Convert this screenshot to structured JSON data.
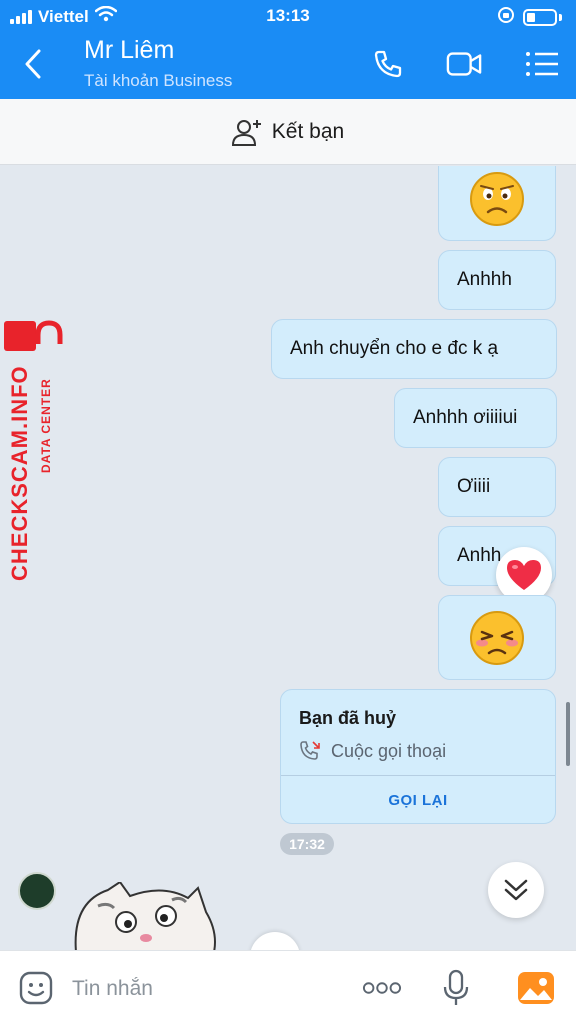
{
  "status_bar": {
    "carrier": "Viettel",
    "time": "13:13"
  },
  "header": {
    "title": "Mr Liêm",
    "subtitle": "Tài khoản Business"
  },
  "friend_bar": {
    "label": "Kết bạn"
  },
  "watermark": {
    "brand": "CHECKSCAM.INFO",
    "tagline": "DATA CENTER",
    "color": "#e8232b"
  },
  "messages": [
    {
      "type": "emoji",
      "icon": "worried-face-icon"
    },
    {
      "type": "text",
      "text": "Anhhh"
    },
    {
      "type": "text",
      "text": "Anh chuyển cho e đc k ạ"
    },
    {
      "type": "text",
      "text": "Anhhh ơiiiiui"
    },
    {
      "type": "text",
      "text": "Ơiiii"
    },
    {
      "type": "text",
      "text": "Anhh",
      "reaction": "heart-icon"
    },
    {
      "type": "emoji",
      "icon": "angry-face-icon"
    }
  ],
  "call_card": {
    "title": "Bạn đã huỷ",
    "detail": "Cuộc gọi thoại",
    "action": "GỌI LẠI"
  },
  "timestamp": "17:32",
  "input_bar": {
    "placeholder": "Tin nhắn"
  },
  "colors": {
    "header": "#1a8cf5",
    "bubble": "#d3edfc",
    "action": "#1a73d9"
  }
}
